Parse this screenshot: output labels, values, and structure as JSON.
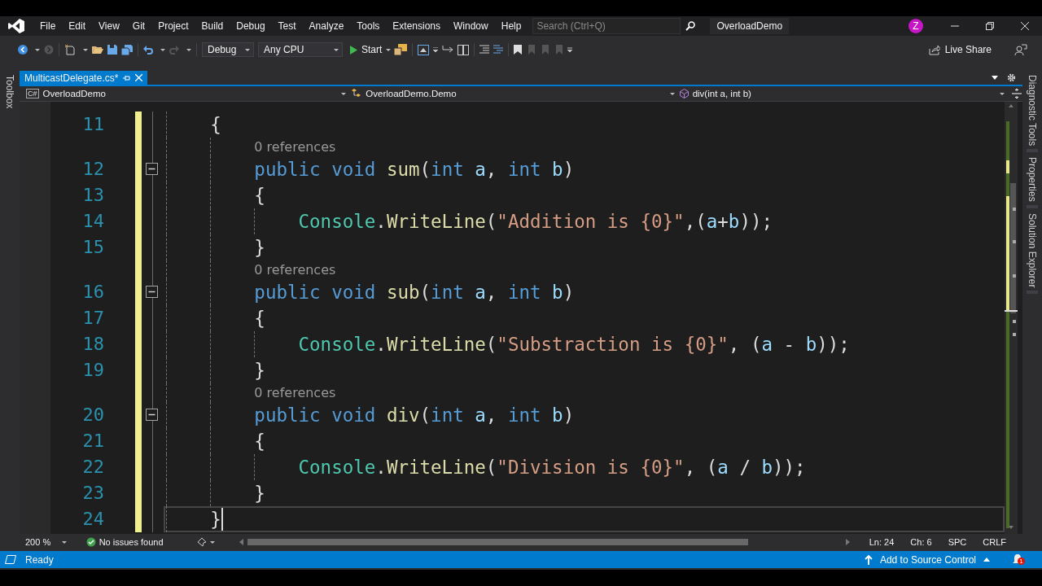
{
  "menu_bar": {
    "items": [
      "File",
      "Edit",
      "View",
      "Git",
      "Project",
      "Build",
      "Debug",
      "Test",
      "Analyze",
      "Tools",
      "Extensions",
      "Window",
      "Help"
    ]
  },
  "search": {
    "placeholder": "Search (Ctrl+Q)"
  },
  "solution_name": "OverloadDemo",
  "account": {
    "initial": "Z"
  },
  "toolbar": {
    "configuration": "Debug",
    "platform": "Any CPU",
    "start": "Start",
    "live_share": "Live Share"
  },
  "left_panel_tabs": [
    "Toolbox"
  ],
  "right_panel_tabs": [
    "Diagnostic Tools",
    "Properties",
    "Solution Explorer"
  ],
  "tabs": [
    {
      "label": "MulticastDelegate.cs*",
      "selected": true
    }
  ],
  "navigation": {
    "project": {
      "badge": "C#",
      "label": "OverloadDemo"
    },
    "type": "OverloadDemo.Demo",
    "member": "div(int a, int b)"
  },
  "editor": {
    "rows": [
      {
        "kind": "code",
        "number": "11",
        "modified": true,
        "tokens": [
          {
            "kind": "plain",
            "text": "    {"
          }
        ]
      },
      {
        "kind": "codelens",
        "modified": true,
        "text": "        0 references"
      },
      {
        "kind": "code",
        "number": "12",
        "modified": true,
        "expanded": true,
        "tokens": [
          {
            "kind": "keyword",
            "text": "        public "
          },
          {
            "kind": "keyword",
            "text": "void "
          },
          {
            "kind": "method",
            "text": "sum"
          },
          {
            "kind": "plain",
            "text": "("
          },
          {
            "kind": "keyword",
            "text": "int "
          },
          {
            "kind": "param",
            "text": "a"
          },
          {
            "kind": "plain",
            "text": ", "
          },
          {
            "kind": "keyword",
            "text": "int "
          },
          {
            "kind": "param",
            "text": "b"
          },
          {
            "kind": "plain",
            "text": ")"
          }
        ]
      },
      {
        "kind": "code",
        "number": "13",
        "modified": true,
        "tokens": [
          {
            "kind": "plain",
            "text": "        {"
          }
        ]
      },
      {
        "kind": "code",
        "number": "14",
        "modified": true,
        "tokens": [
          {
            "kind": "type",
            "text": "            Console"
          },
          {
            "kind": "plain",
            "text": "."
          },
          {
            "kind": "method",
            "text": "WriteLine"
          },
          {
            "kind": "plain",
            "text": "("
          },
          {
            "kind": "string",
            "text": "\"Addition is {0}\""
          },
          {
            "kind": "plain",
            "text": ",("
          },
          {
            "kind": "param",
            "text": "a"
          },
          {
            "kind": "plain",
            "text": "+"
          },
          {
            "kind": "param",
            "text": "b"
          },
          {
            "kind": "plain",
            "text": "));"
          }
        ]
      },
      {
        "kind": "code",
        "number": "15",
        "modified": true,
        "tokens": [
          {
            "kind": "plain",
            "text": "        }"
          }
        ]
      },
      {
        "kind": "codelens",
        "modified": true,
        "text": "        0 references"
      },
      {
        "kind": "code",
        "number": "16",
        "modified": true,
        "expanded": true,
        "tokens": [
          {
            "kind": "keyword",
            "text": "        public "
          },
          {
            "kind": "keyword",
            "text": "void "
          },
          {
            "kind": "method",
            "text": "sub"
          },
          {
            "kind": "plain",
            "text": "("
          },
          {
            "kind": "keyword",
            "text": "int "
          },
          {
            "kind": "param",
            "text": "a"
          },
          {
            "kind": "plain",
            "text": ", "
          },
          {
            "kind": "keyword",
            "text": "int "
          },
          {
            "kind": "param",
            "text": "b"
          },
          {
            "kind": "plain",
            "text": ")"
          }
        ]
      },
      {
        "kind": "code",
        "number": "17",
        "modified": true,
        "tokens": [
          {
            "kind": "plain",
            "text": "        {"
          }
        ]
      },
      {
        "kind": "code",
        "number": "18",
        "modified": true,
        "tokens": [
          {
            "kind": "type",
            "text": "            Console"
          },
          {
            "kind": "plain",
            "text": "."
          },
          {
            "kind": "method",
            "text": "WriteLine"
          },
          {
            "kind": "plain",
            "text": "("
          },
          {
            "kind": "string",
            "text": "\"Substraction is {0}\""
          },
          {
            "kind": "plain",
            "text": ", ("
          },
          {
            "kind": "param",
            "text": "a"
          },
          {
            "kind": "plain",
            "text": " - "
          },
          {
            "kind": "param",
            "text": "b"
          },
          {
            "kind": "plain",
            "text": "));"
          }
        ]
      },
      {
        "kind": "code",
        "number": "19",
        "modified": true,
        "tokens": [
          {
            "kind": "plain",
            "text": "        }"
          }
        ]
      },
      {
        "kind": "codelens",
        "modified": true,
        "text": "        0 references"
      },
      {
        "kind": "code",
        "number": "20",
        "modified": true,
        "expanded": true,
        "tokens": [
          {
            "kind": "keyword",
            "text": "        public "
          },
          {
            "kind": "keyword",
            "text": "void "
          },
          {
            "kind": "method",
            "text": "div"
          },
          {
            "kind": "plain",
            "text": "("
          },
          {
            "kind": "keyword",
            "text": "int "
          },
          {
            "kind": "param",
            "text": "a"
          },
          {
            "kind": "plain",
            "text": ", "
          },
          {
            "kind": "keyword",
            "text": "int "
          },
          {
            "kind": "param",
            "text": "b"
          },
          {
            "kind": "plain",
            "text": ")"
          }
        ]
      },
      {
        "kind": "code",
        "number": "21",
        "modified": true,
        "tokens": [
          {
            "kind": "plain",
            "text": "        {"
          }
        ]
      },
      {
        "kind": "code",
        "number": "22",
        "modified": true,
        "tokens": [
          {
            "kind": "type",
            "text": "            Console"
          },
          {
            "kind": "plain",
            "text": "."
          },
          {
            "kind": "method",
            "text": "WriteLine"
          },
          {
            "kind": "plain",
            "text": "("
          },
          {
            "kind": "string",
            "text": "\"Division is {0}\""
          },
          {
            "kind": "plain",
            "text": ", ("
          },
          {
            "kind": "param",
            "text": "a"
          },
          {
            "kind": "plain",
            "text": " / "
          },
          {
            "kind": "param",
            "text": "b"
          },
          {
            "kind": "plain",
            "text": "));"
          }
        ]
      },
      {
        "kind": "code",
        "number": "23",
        "modified": true,
        "tokens": [
          {
            "kind": "plain",
            "text": "        }"
          }
        ]
      },
      {
        "kind": "code",
        "number": "24",
        "modified": true,
        "current": true,
        "tokens": [
          {
            "kind": "plain",
            "text": "    }"
          }
        ]
      }
    ]
  },
  "editor_footer": {
    "zoom": "200 %",
    "issues": "No issues found",
    "line": "Ln: 24",
    "column": "Ch: 6",
    "whitespace": "SPC",
    "line_ending": "CRLF"
  },
  "status_bar": {
    "message": "Ready",
    "source_control": "Add to Source Control",
    "notifications": "1"
  }
}
